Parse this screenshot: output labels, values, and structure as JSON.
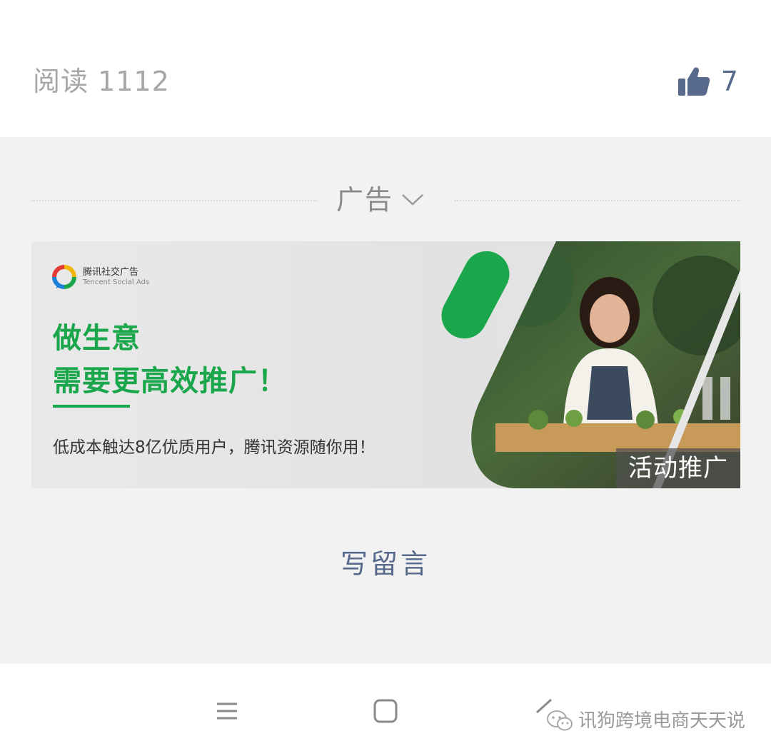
{
  "article_footer": {
    "read_count_text": "阅读 1112",
    "like_count": "7"
  },
  "ad": {
    "label": "广告",
    "brand_cn": "腾讯社交广告",
    "brand_en": "Tencent Social Ads",
    "headline_line1": "做生意",
    "headline_line2": "需要更高效推广！",
    "description": "低成本触达8亿优质用户，腾讯资源随你用！",
    "cta": "活动推广",
    "accent_color": "#1aa64a"
  },
  "comment": {
    "write_label": "写留言"
  },
  "nav": {
    "icons": [
      "menu-icon",
      "home-icon",
      "back-icon"
    ]
  },
  "watermark": {
    "text": "讯狗跨境电商天天说"
  }
}
